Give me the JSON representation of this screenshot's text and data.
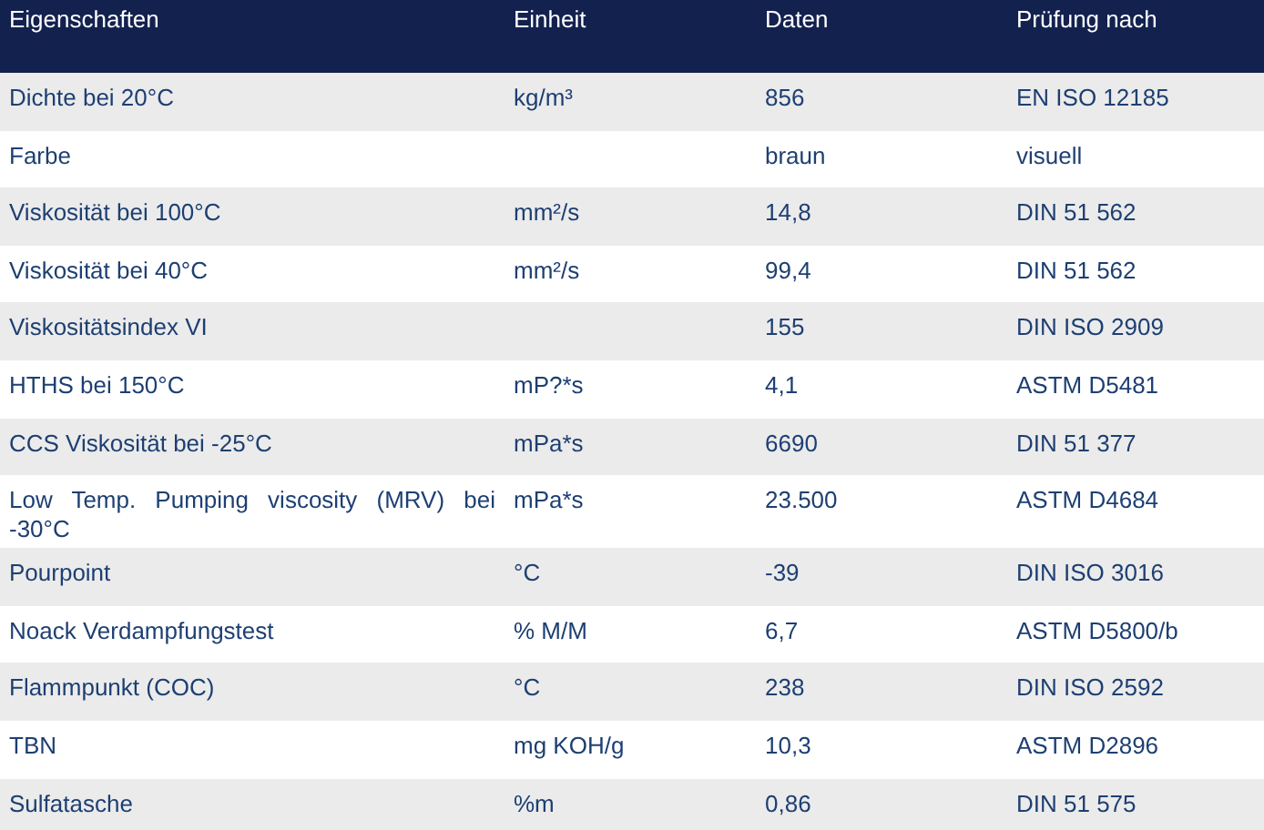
{
  "table": {
    "columns": [
      "Eigenschaften",
      "Einheit",
      "Daten",
      "Prüfung nach"
    ],
    "rows": [
      {
        "property": "Dichte bei 20°C",
        "unit": "kg/m³",
        "value": "856",
        "method": "EN ISO 12185"
      },
      {
        "property": "Farbe",
        "value": "braun",
        "method": "visuell"
      },
      {
        "property": "Viskosität bei 100°C",
        "unit": "mm²/s",
        "value": "14,8",
        "method": "DIN 51 562"
      },
      {
        "property": "Viskosität bei 40°C",
        "unit": "mm²/s",
        "value": "99,4",
        "method": "DIN 51 562"
      },
      {
        "property": "Viskositätsindex VI",
        "value": "155",
        "method": "DIN ISO 2909"
      },
      {
        "property": "HTHS bei 150°C",
        "unit": "mP?*s",
        "value": "4,1",
        "method": "ASTM D5481"
      },
      {
        "property": "CCS Viskosität bei -25°C",
        "unit": "mPa*s",
        "value": "6690",
        "method": "DIN 51 377"
      },
      {
        "property": "Low Temp. Pumping viscosity (MRV) bei -30°C",
        "unit": "mPa*s",
        "value": "23.500",
        "method": "ASTM D4684"
      },
      {
        "property": "Pourpoint",
        "unit": "°C",
        "value": "-39",
        "method": "DIN ISO 3016"
      },
      {
        "property": "Noack Verdampfungstest",
        "unit": "% M/M",
        "value": "6,7",
        "method": "ASTM D5800/b"
      },
      {
        "property": "Flammpunkt (COC)",
        "unit": "°C",
        "value": "238",
        "method": "DIN ISO 2592"
      },
      {
        "property": "TBN",
        "unit": "mg KOH/g",
        "value": "10,3",
        "method": "ASTM D2896"
      },
      {
        "property": "Sulfatasche",
        "unit": "%m",
        "value": "0,86",
        "method": "DIN 51 575"
      }
    ]
  }
}
